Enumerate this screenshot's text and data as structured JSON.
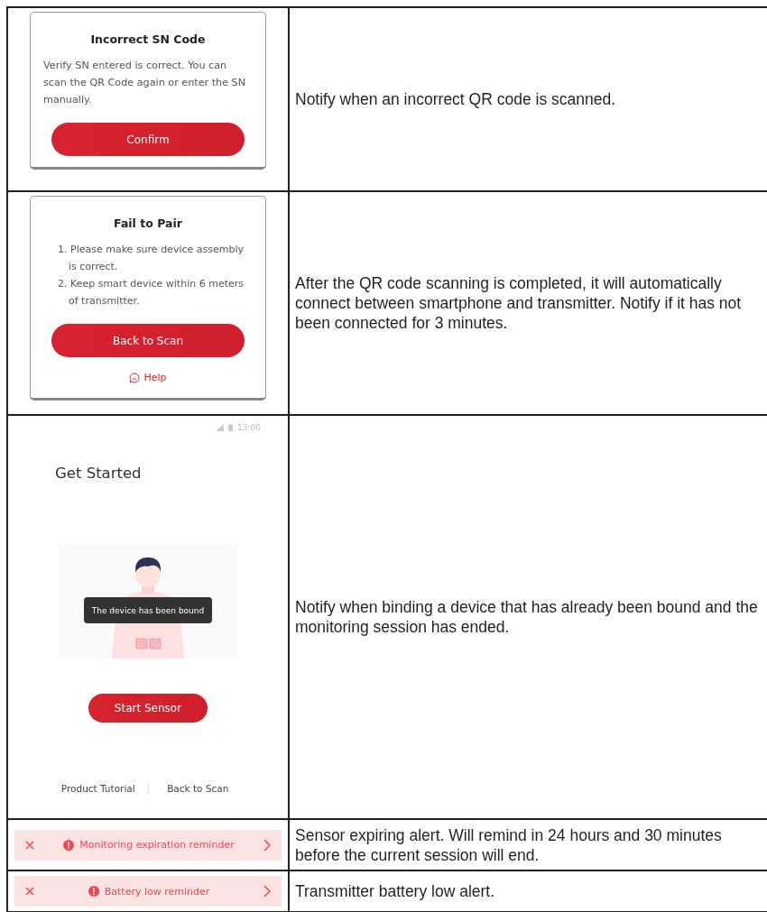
{
  "rows": [
    {
      "kind": "dialog",
      "title": "Incorrect SN Code",
      "body": "Verify SN entered is correct. You can scan the QR Code again or enter the SN manually.",
      "button": "Confirm",
      "description": "Notify when an incorrect QR code is scanned."
    },
    {
      "kind": "dialog",
      "title": "Fail to Pair",
      "steps": [
        "1. Please make sure device assembly is correct.",
        "2. Keep smart device within 6 meters of transmitter."
      ],
      "button": "Back to Scan",
      "help_link": "Help",
      "description": "After the QR code scanning is completed, it will automatically connect between smartphone and transmitter. Notify if it has not been connected for 3 minutes."
    },
    {
      "kind": "screen",
      "time": "13:00",
      "title": "Get Started",
      "toast": "The device has been bound",
      "button": "Start Sensor",
      "links": [
        "Product Tutorial",
        "Back to Scan"
      ],
      "description": "Notify when binding a device that has already been bound and the monitoring session has ended."
    },
    {
      "kind": "banner",
      "message": "Monitoring expiration reminder",
      "description": "Sensor expiring alert. Will remind in 24 hours and 30 minutes before the current session will end."
    },
    {
      "kind": "banner",
      "message": "Battery low reminder",
      "description": "Transmitter battery low alert."
    }
  ]
}
